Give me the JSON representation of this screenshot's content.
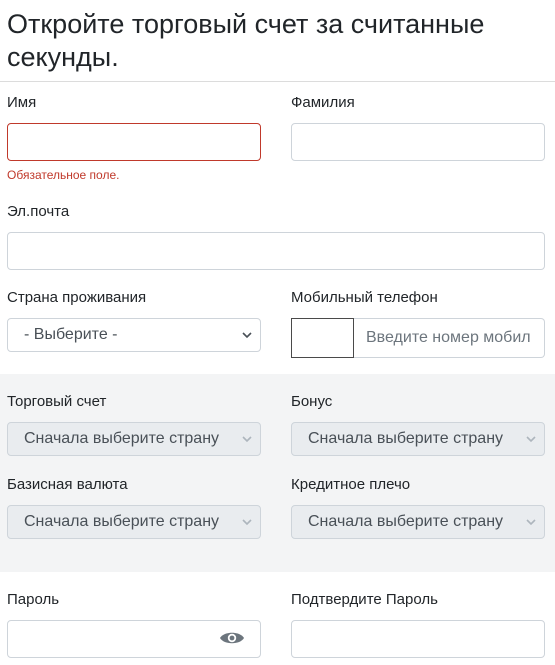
{
  "header": {
    "title": "Откройте торговый счет за считанные секунды."
  },
  "form": {
    "first_name": {
      "label": "Имя",
      "value": "",
      "error": "Обязательное поле."
    },
    "last_name": {
      "label": "Фамилия",
      "value": ""
    },
    "email": {
      "label": "Эл.почта",
      "value": ""
    },
    "country": {
      "label": "Страна проживания",
      "selected": "- Выберите -"
    },
    "phone": {
      "label": "Мобильный телефон",
      "code": "",
      "placeholder": "Введите номер мобил"
    },
    "trading_account": {
      "label": "Торговый счет",
      "selected": "Сначала выберите страну"
    },
    "bonus": {
      "label": "Бонус",
      "selected": "Сначала выберите страну"
    },
    "base_currency": {
      "label": "Базисная валюта",
      "selected": "Сначала выберите страну"
    },
    "leverage": {
      "label": "Кредитное плечо",
      "selected": "Сначала выберите страну"
    },
    "password": {
      "label": "Пароль",
      "value": ""
    },
    "confirm_password": {
      "label": "Подтвердите Пароль",
      "value": ""
    }
  },
  "icons": {
    "chevron": "chevron-down-icon",
    "eye": "eye-icon"
  },
  "colors": {
    "error": "#c0392b",
    "disabled_bg": "#e9ecef",
    "band_bg": "#f3f4f5"
  }
}
